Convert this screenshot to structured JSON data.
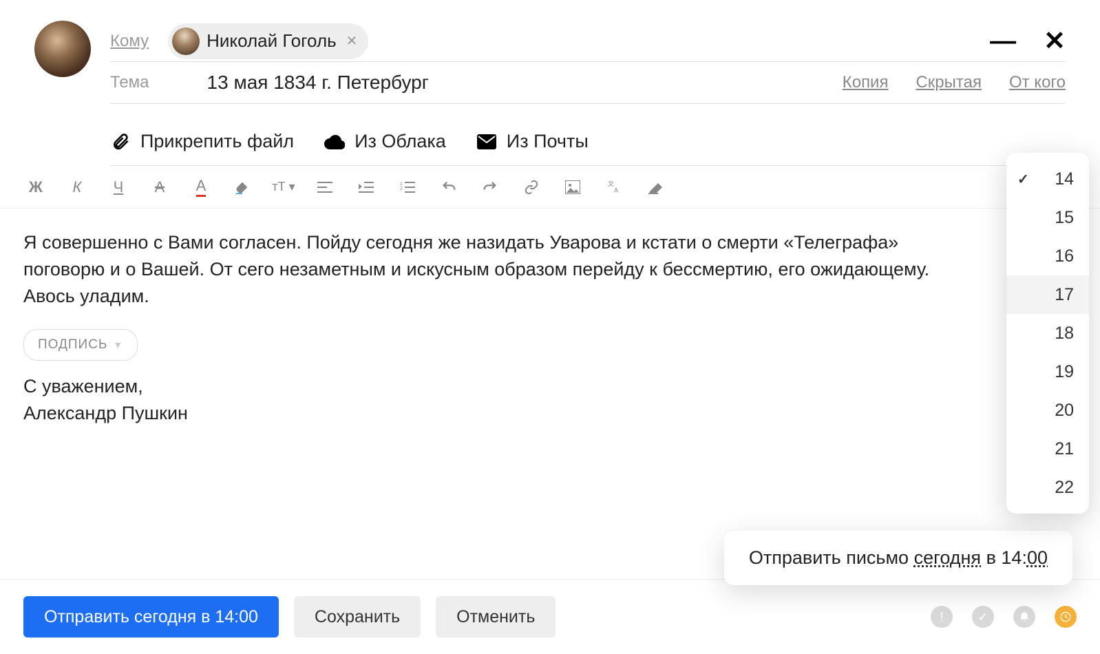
{
  "header": {
    "to_label": "Кому",
    "subject_label": "Тема",
    "subject_value": "13 мая 1834 г. Петербург",
    "links": {
      "cc": "Копия",
      "bcc": "Скрытая",
      "from": "От кого"
    }
  },
  "recipient": {
    "name": "Николай Гоголь"
  },
  "attachments": {
    "file": "Прикрепить файл",
    "cloud": "Из Облака",
    "mail": "Из Почты"
  },
  "body": {
    "text": "Я совершенно с Вами согласен. Пойду сегодня же назидать Уварова и кстати о смерти «Телеграфа» поговорю и о Вашей. От сего незаметным и искусным образом перейду к бессмертию, его ожидающему. Авось уладим."
  },
  "signature": {
    "button_label": "ПОДПИСЬ",
    "greeting": "С уважением,",
    "name": "Александр Пушкин"
  },
  "footer": {
    "send_label": "Отправить сегодня в 14:00",
    "save_label": "Сохранить",
    "cancel_label": "Отменить"
  },
  "schedule_popup": {
    "prefix": "Отправить письмо ",
    "day": "сегодня",
    "mid": " в 14:",
    "minutes": "00"
  },
  "hours": {
    "options": [
      "14",
      "15",
      "16",
      "17",
      "18",
      "19",
      "20",
      "21",
      "22"
    ],
    "selected": "14",
    "hover": "17"
  }
}
